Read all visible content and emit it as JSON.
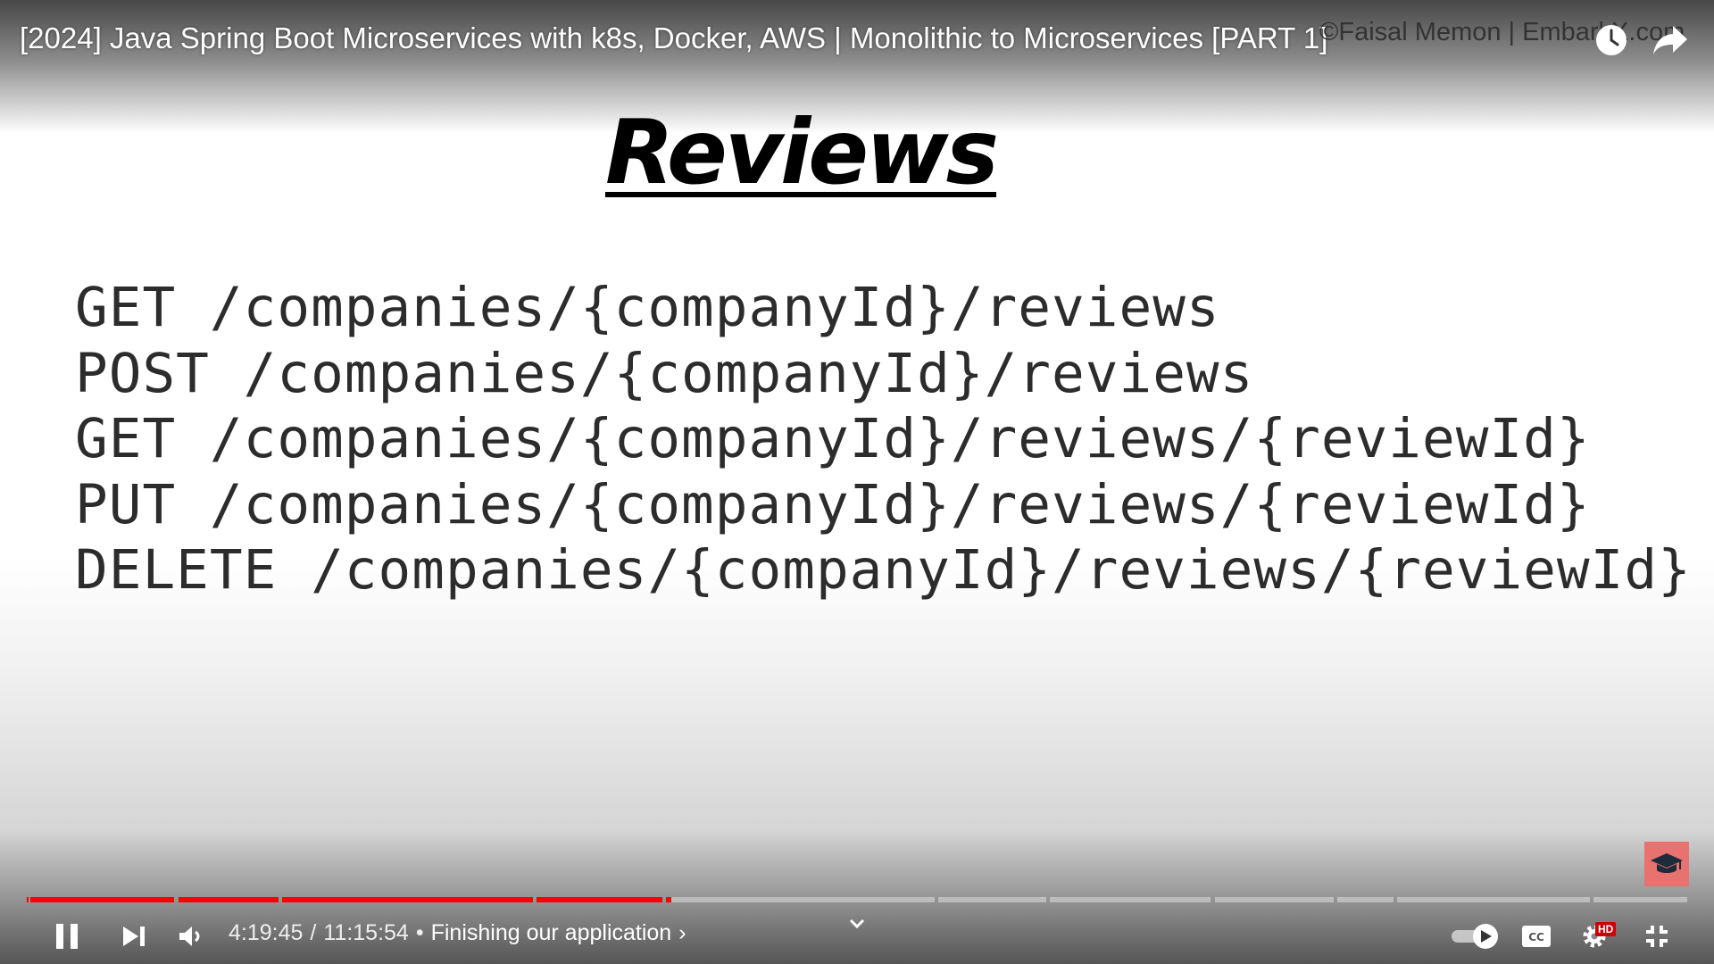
{
  "player": {
    "video_title": "[2024] Java Spring Boot Microservices with k8s, Docker, AWS | Monolithic to Microservices [PART 1]",
    "watermark": "©Faisal Memon | EmbarkX.com",
    "icons": {
      "watch_later": "clock-icon",
      "share": "share-arrow-icon",
      "extension": "graduation-cap-icon",
      "pause": "pause-icon",
      "next": "next-track-icon",
      "volume": "volume-icon",
      "chapters_toggle": "chevron-down-icon",
      "autoplay": "autoplay-toggle-icon",
      "captions": "captions-icon",
      "settings": "gear-icon",
      "exit_fullscreen": "exit-fullscreen-icon"
    },
    "accent_color": "#ff0000",
    "progress_fraction": 0.388
  },
  "slide": {
    "heading": "Reviews",
    "endpoints": [
      "GET /companies/{companyId}/reviews",
      "POST /companies/{companyId}/reviews",
      "GET /companies/{companyId}/reviews/{reviewId}",
      "PUT /companies/{companyId}/reviews/{reviewId}",
      "DELETE /companies/{companyId}/reviews/{reviewId}"
    ]
  },
  "controls": {
    "current_time": "4:19:45",
    "time_separator": "/",
    "duration": "11:15:54",
    "chapter_separator": "•",
    "chapter_title": "Finishing our application",
    "chevron": "›",
    "hd_badge": "HD"
  }
}
